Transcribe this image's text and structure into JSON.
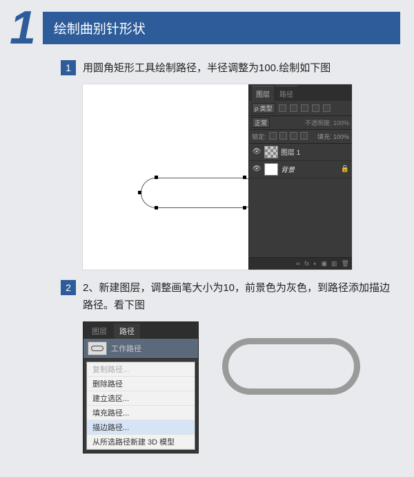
{
  "section": {
    "number": "1",
    "title": "绘制曲别针形状"
  },
  "steps": [
    {
      "num": "1",
      "text": "用圆角矩形工具绘制路径，半径调整为100.绘制如下图"
    },
    {
      "num": "2",
      "text": "2、新建图层，调整画笔大小为10，前景色为灰色，到路径添加描边路径。看下图"
    }
  ],
  "layers_panel": {
    "tab_active": "图层",
    "tab_inactive": "路径",
    "filter_label": "ρ 类型",
    "blend_mode": "正常",
    "opacity_label": "不透明度:",
    "opacity_value": "100%",
    "lock_label": "锁定:",
    "fill_label": "填充:",
    "fill_value": "100%",
    "layer1": "图层 1",
    "layer_bg": "背景",
    "footer_icons": [
      "∞",
      "fx",
      "◐",
      "▣",
      "▥",
      "🗑"
    ]
  },
  "paths_panel": {
    "tab_active": "路径",
    "tab_inactive": "图层",
    "work_path": "工作路径"
  },
  "context_menu": {
    "items": [
      {
        "label": "复制路径...",
        "disabled": true
      },
      {
        "label": "删除路径",
        "disabled": false
      },
      {
        "label": "建立选区...",
        "disabled": false
      },
      {
        "label": "填充路径...",
        "disabled": false
      },
      {
        "label": "描边路径...",
        "disabled": false,
        "hl": true
      },
      {
        "label": "从所选路径新建 3D 模型",
        "disabled": false
      }
    ]
  }
}
